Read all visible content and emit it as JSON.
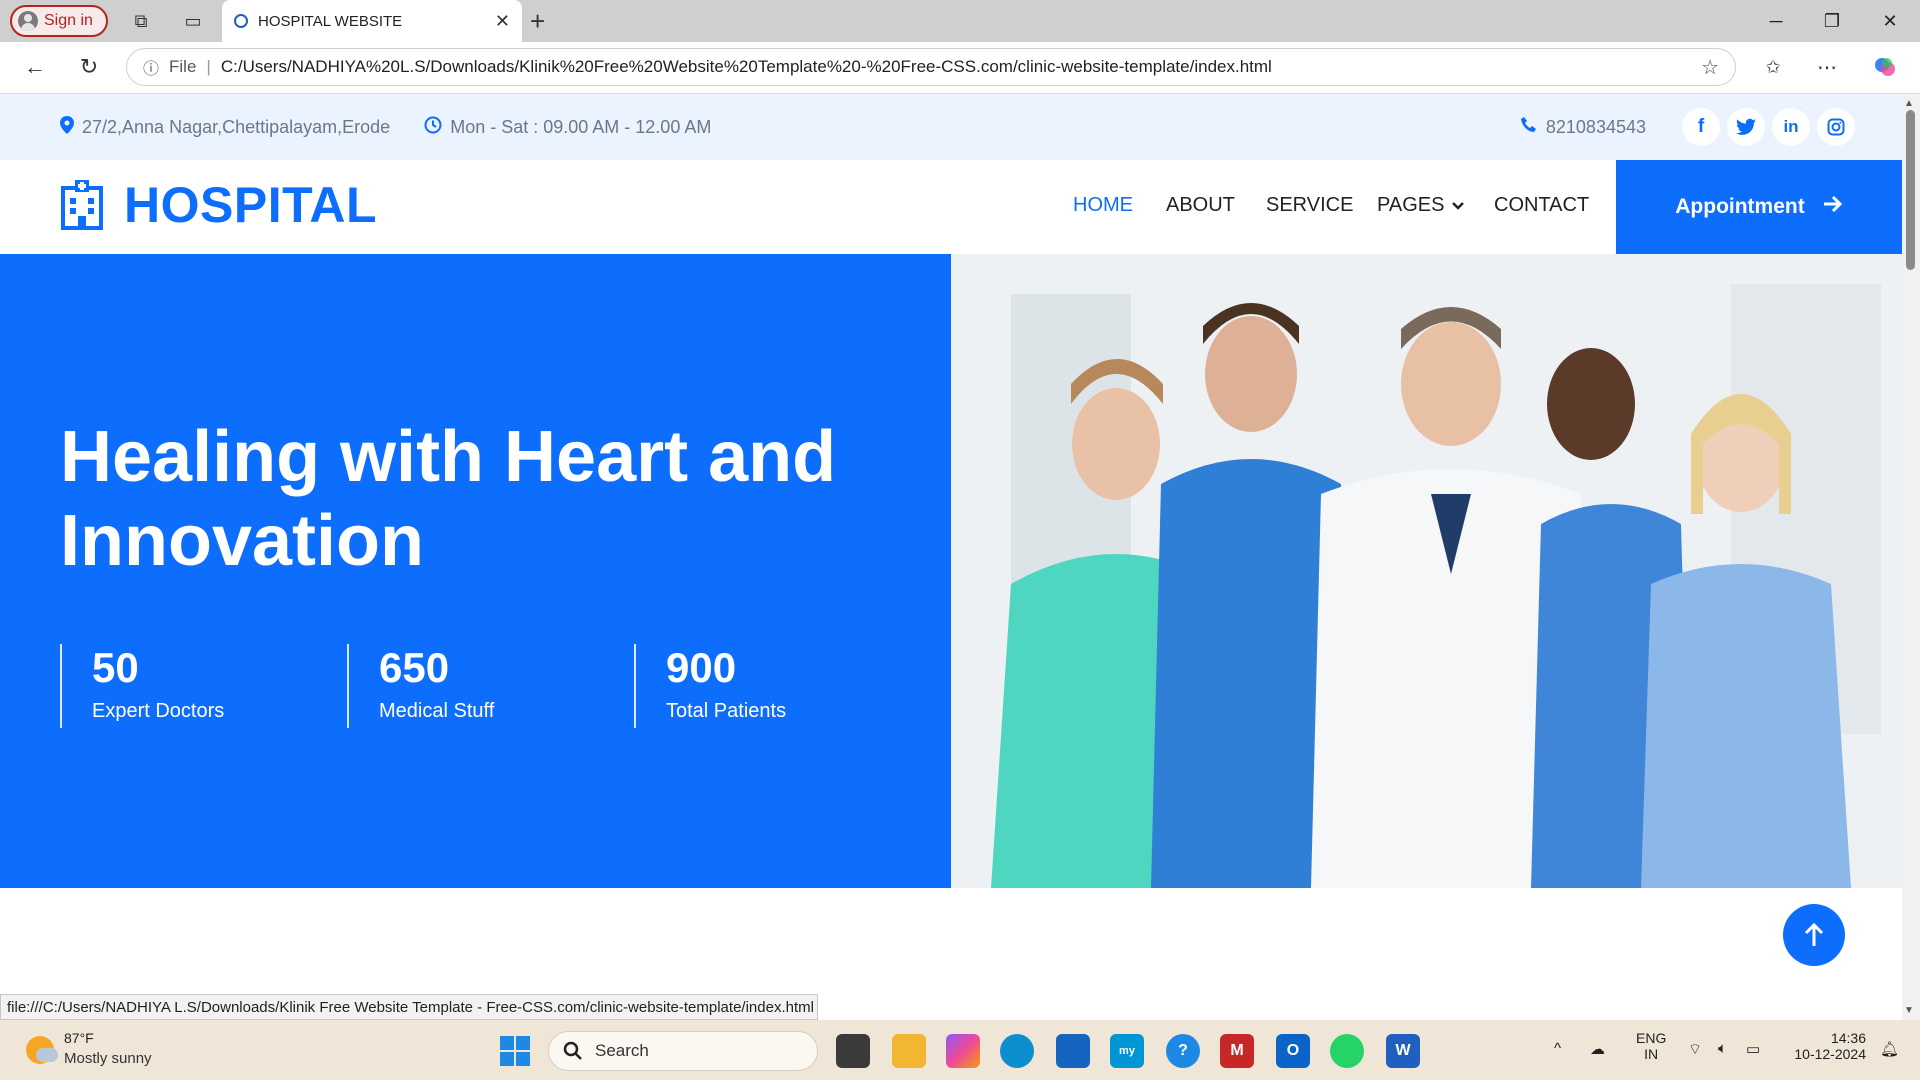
{
  "browser": {
    "signin_label": "Sign in",
    "tab_title": "HOSPITAL WEBSITE",
    "address_prefix": "File",
    "url": "C:/Users/NADHIYA%20L.S/Downloads/Klinik%20Free%20Website%20Template%20-%20Free-CSS.com/clinic-website-template/index.html",
    "status_url": "file:///C:/Users/NADHIYA L.S/Downloads/Klinik Free Website Template - Free-CSS.com/clinic-website-template/index.html"
  },
  "topbar": {
    "address": "27/2,Anna Nagar,Chettipalayam,Erode",
    "hours": "Mon - Sat : 09.00 AM - 12.00 AM",
    "phone": "8210834543",
    "social": [
      "f",
      "t",
      "in",
      "ig"
    ]
  },
  "navbar": {
    "logo": "HOSPITAL",
    "links": [
      "HOME",
      "ABOUT",
      "SERVICE",
      "PAGES",
      "CONTACT"
    ],
    "active": "HOME",
    "cta": "Appointment"
  },
  "hero": {
    "title": "Healing with Heart and Innovation",
    "stats": [
      {
        "value": "50",
        "label": "Expert Doctors"
      },
      {
        "value": "650",
        "label": "Medical Stuff"
      },
      {
        "value": "900",
        "label": "Total Patients"
      }
    ]
  },
  "taskbar": {
    "weather_temp": "87°F",
    "weather_desc": "Mostly sunny",
    "search_label": "Search",
    "lang_top": "ENG",
    "lang_bottom": "IN",
    "time": "14:36",
    "date": "10-12-2024"
  },
  "colors": {
    "brand": "#0d6efd",
    "nav_active": "#0d6efd"
  }
}
